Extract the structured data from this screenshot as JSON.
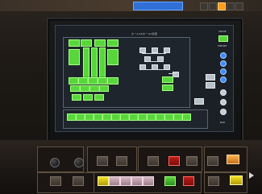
{
  "device": {
    "top_display_color": "#2f6fd6",
    "accent_orange": "#ff9c1a",
    "screen_green": "#58d63b",
    "screen_blue": "#3b8bff",
    "button_red": "#c01b15",
    "button_yellow": "#f4e31f"
  },
  "screen": {
    "title": "ホール1&ホール2系統",
    "right_column": {
      "top_label": "MODE",
      "top_button": "ON",
      "mid_label": "PRESET",
      "bottom_label": "BAR"
    }
  },
  "icons": {
    "arrow": "arrow-right-icon"
  }
}
